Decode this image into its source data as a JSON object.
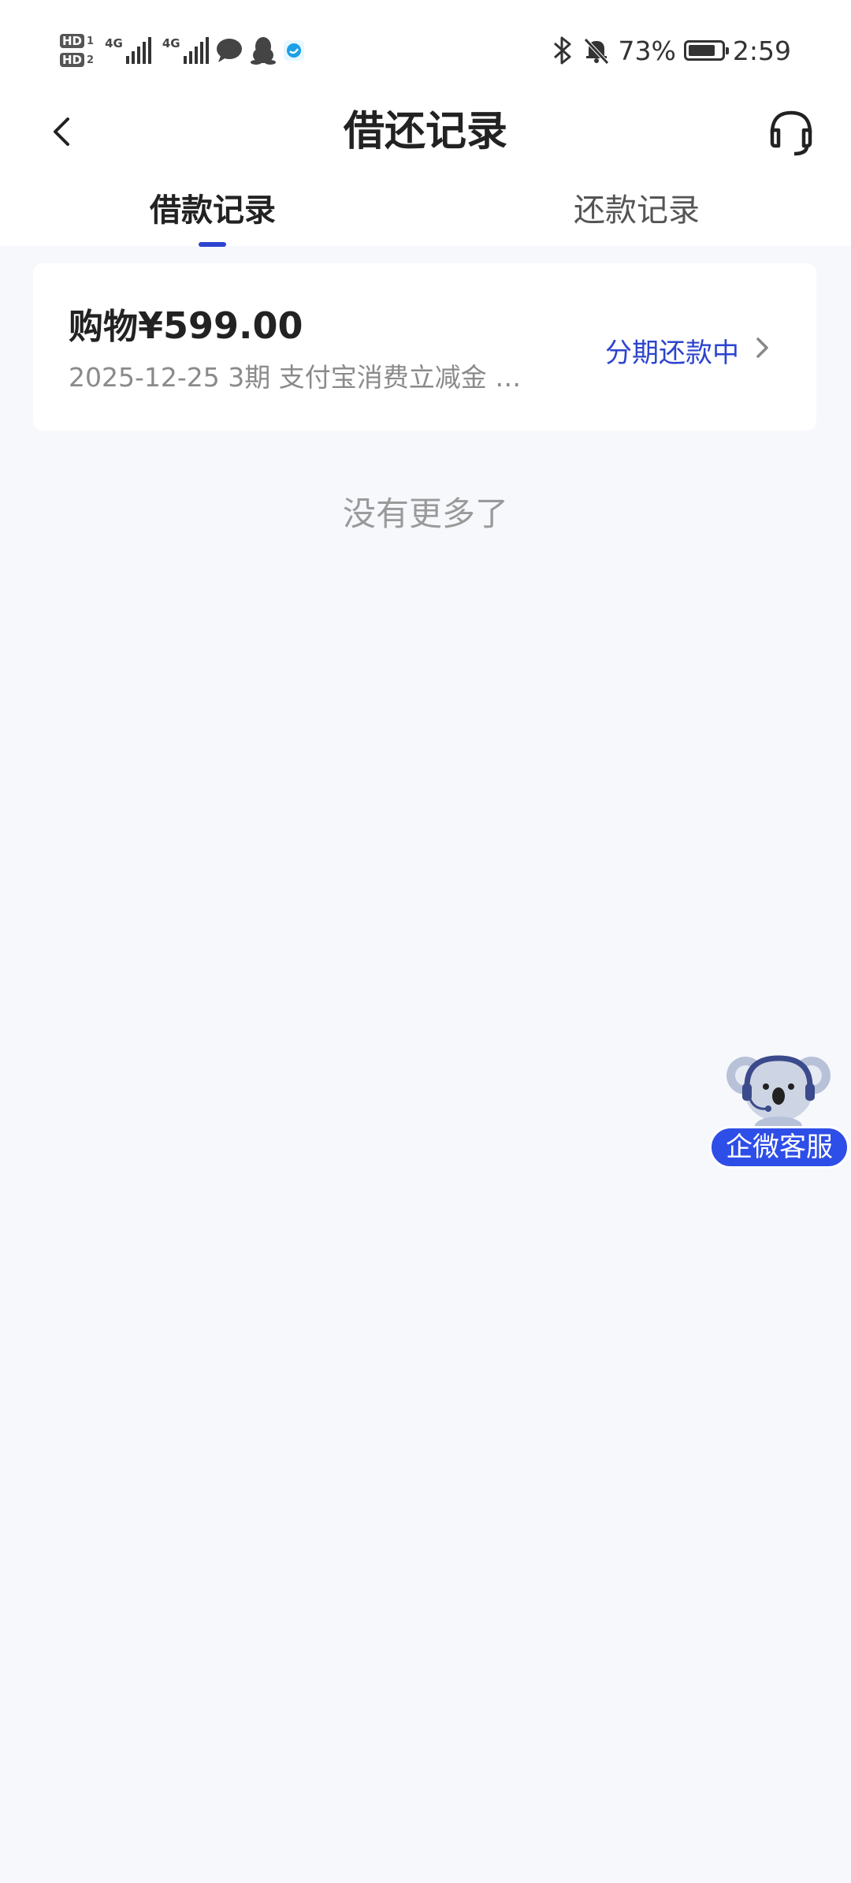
{
  "status_bar": {
    "hd1": "HD",
    "hd1_num": "1",
    "hd2": "HD",
    "hd2_num": "2",
    "net1": "4G",
    "net2": "4G",
    "battery_pct": "73%",
    "time": "2:59",
    "battery_level": 0.73
  },
  "nav": {
    "title": "借还记录"
  },
  "tabs": [
    {
      "label": "借款记录",
      "active": true
    },
    {
      "label": "还款记录",
      "active": false
    }
  ],
  "record": {
    "type_label": "购物",
    "amount": "¥599.00",
    "meta": "2025-12-25 3期  支付宝消费立减金 消...",
    "status": "分期还款中"
  },
  "list_end": "没有更多了",
  "float_service": {
    "label": "企微客服"
  },
  "colors": {
    "accent": "#2d44ce",
    "background": "#f7f8fc",
    "pill": "#2e4ee8"
  }
}
